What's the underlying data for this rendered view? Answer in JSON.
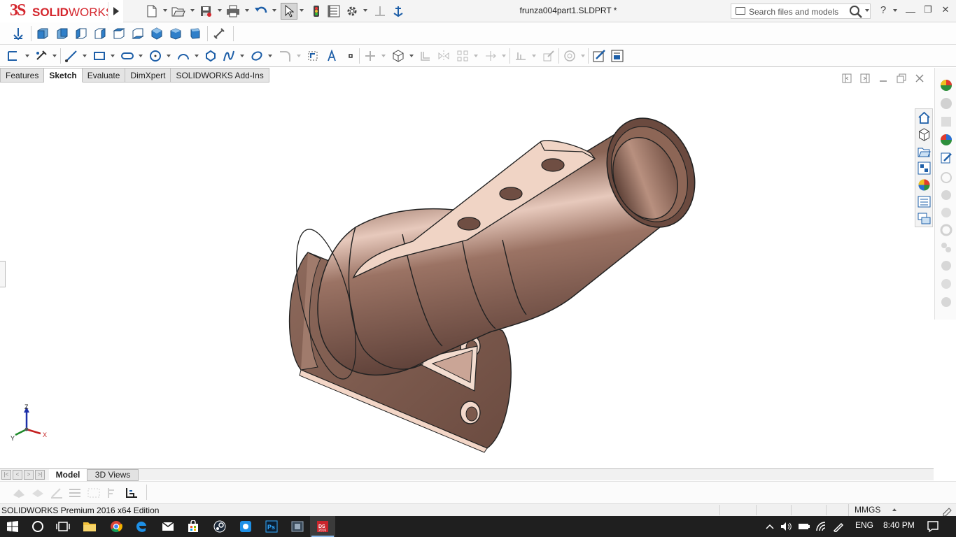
{
  "app": {
    "brand_prefix": "3S",
    "brand_bold": "SOLID",
    "brand_light": "WORKS",
    "document_title": "frunza004part1.SLDPRT *"
  },
  "search": {
    "placeholder": "Search files and models"
  },
  "title_buttons": {
    "help": "?",
    "minimize": "—",
    "restore": "❐",
    "close": "✕"
  },
  "command_tabs": [
    {
      "label": "Features",
      "active": false
    },
    {
      "label": "Sketch",
      "active": true
    },
    {
      "label": "Evaluate",
      "active": false
    },
    {
      "label": "DimXpert",
      "active": false
    },
    {
      "label": "SOLIDWORKS Add-Ins",
      "active": false
    }
  ],
  "model_tabs": {
    "model": "Model",
    "views_3d": "3D Views"
  },
  "triad": {
    "z": "Z",
    "y": "Y",
    "x": "X"
  },
  "status": {
    "edition": "SOLIDWORKS Premium 2016 x64 Edition",
    "units": "MMGS"
  },
  "tray": {
    "language": "ENG",
    "time": "8:40 PM"
  },
  "colors": {
    "brand_red": "#d4262d",
    "part_body": "#8a6456",
    "part_highlight": "#e6c7b8",
    "taskbar": "#1f1f1f",
    "accent_blue": "#1e5fa8"
  },
  "icons": {
    "row1": [
      "new-document-icon",
      "open-folder-icon",
      "save-icon",
      "print-icon",
      "undo-icon",
      "select-pointer-icon",
      "traffic-light-icon",
      "file-properties-icon",
      "options-gear-icon",
      "reference-geometry-icon",
      "anchor-icon"
    ],
    "row2": [
      "normal-to-icon",
      "front-view-icon",
      "back-view-icon",
      "left-view-icon",
      "right-view-icon",
      "top-view-icon",
      "bottom-view-icon",
      "isometric-view-icon",
      "trimetric-view-icon",
      "dimetric-view-icon",
      "smart-dimension-icon"
    ],
    "row3": [
      "sketch-icon",
      "smart-dimension-tool-icon",
      "line-icon",
      "rectangle-icon",
      "slot-icon",
      "circle-icon",
      "arc-icon",
      "polygon-icon",
      "spline-icon",
      "ellipse-icon",
      "fillet-icon",
      "offset-icon",
      "text-icon",
      "point-icon",
      "trim-icon",
      "convert-entities-icon",
      "mirror-icon",
      "linear-pattern-icon",
      "move-entities-icon",
      "relations-icon",
      "repair-sketch-icon",
      "quick-snaps-icon",
      "rapid-sketch-icon",
      "instant2d-icon"
    ]
  }
}
